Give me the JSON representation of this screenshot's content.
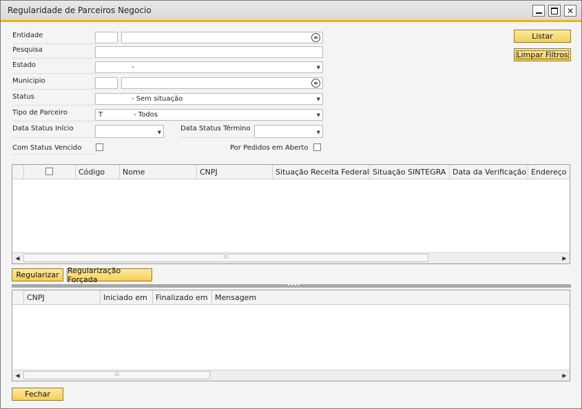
{
  "window": {
    "title": "Regularidade de Parceiros Negocio"
  },
  "form": {
    "entidade_label": "Entidade",
    "pesquisa_label": "Pesquisa",
    "estado_label": "Estado",
    "estado_value": "-",
    "municipio_label": "Municipio",
    "status_label": "Status",
    "status_value": "- Sem situação",
    "tipo_label": "Tipo de Parceiro",
    "tipo_code": "T",
    "tipo_value": "- Todos",
    "data_inicio_label": "Data Status Início",
    "data_termino_label": "Data Status Término",
    "vencido_label": "Com Status Vencido",
    "pedidos_label": "Por Pedidos em Aberto"
  },
  "buttons": {
    "listar": "Listar",
    "limpar": "Limpar Filtros",
    "regularizar": "Regularizar",
    "regularizacao_forcada": "Regularização Forçada",
    "fechar": "Fechar"
  },
  "grid1": {
    "columns": [
      "Código",
      "Nome",
      "CNPJ",
      "Situação Receita Federal",
      "Situação SINTEGRA",
      "Data da Verificação",
      "Endereço"
    ]
  },
  "grid2": {
    "columns": [
      "CNPJ",
      "Iniciado em",
      "Finalizado em",
      "Mensagem"
    ]
  }
}
